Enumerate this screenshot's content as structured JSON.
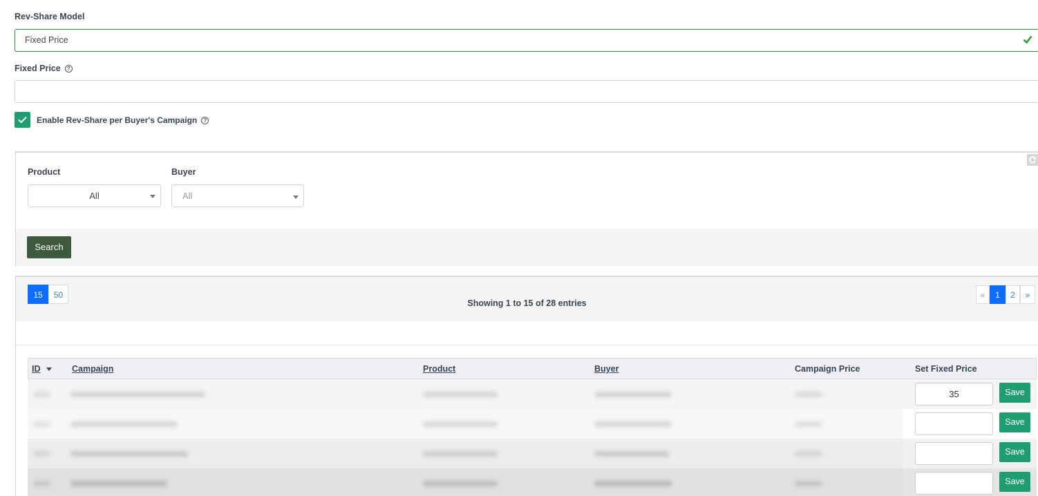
{
  "form": {
    "revshare_label": "Rev-Share Model",
    "revshare_value": "Fixed Price",
    "fixed_price_label": "Fixed Price",
    "fixed_price_value": "",
    "enable_label": "Enable Rev-Share per Buyer's Campaign",
    "enable_checked": true,
    "help_glyph": "?"
  },
  "filters": {
    "product_label": "Product",
    "product_value": "All",
    "buyer_label": "Buyer",
    "buyer_value": "All",
    "search_label": "Search"
  },
  "table": {
    "page_sizes": [
      "15",
      "50"
    ],
    "active_page_size": "15",
    "entries_text": "Showing 1 to 15 of 28 entries",
    "pagination": {
      "prev": "«",
      "pages": [
        "1",
        "2"
      ],
      "active": "1",
      "next": "»"
    },
    "columns": {
      "id": "ID",
      "campaign": "Campaign",
      "product": "Product",
      "buyer": "Buyer",
      "campaign_price": "Campaign Price",
      "set_fixed_price": "Set Fixed Price"
    },
    "rows": [
      {
        "fixed_price": "35",
        "save_label": "Save"
      },
      {
        "fixed_price": "",
        "save_label": "Save"
      },
      {
        "fixed_price": "",
        "save_label": "Save"
      },
      {
        "fixed_price": "",
        "save_label": "Save"
      }
    ]
  },
  "colors": {
    "accent_green": "#1e9e6e",
    "search_button": "#3d5a3e",
    "active_blue": "#0d6efd"
  }
}
